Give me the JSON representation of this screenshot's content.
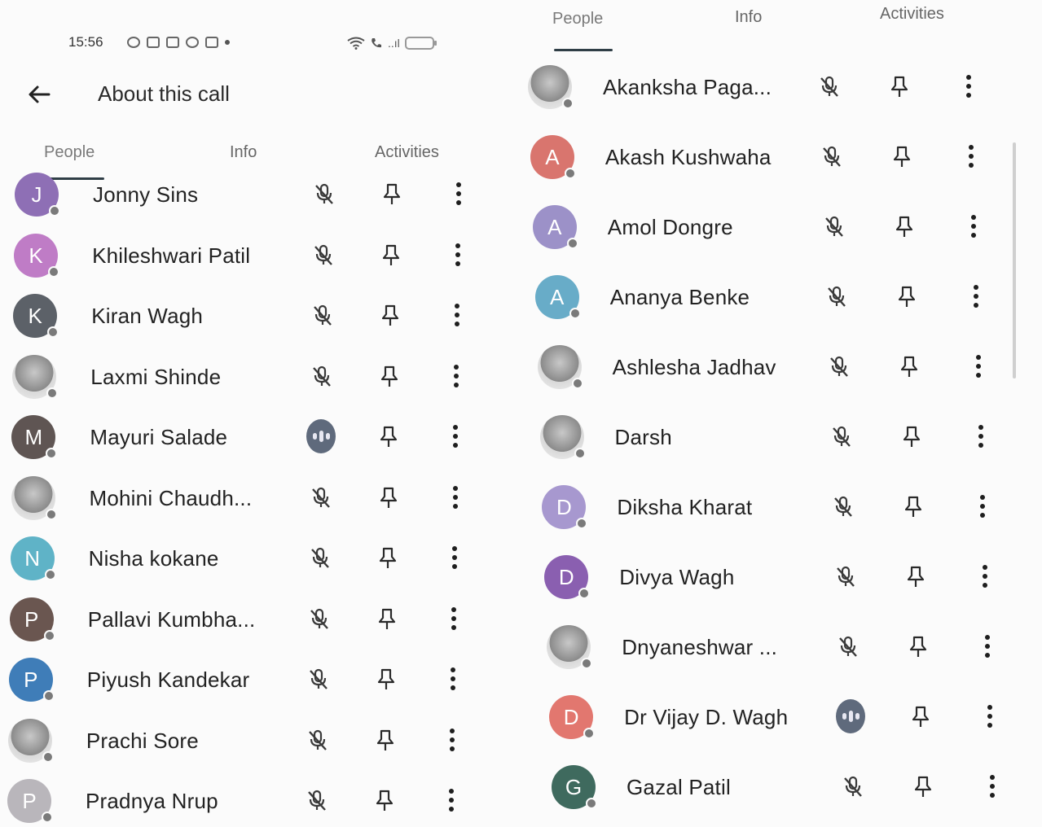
{
  "status_bar": {
    "time": "15:56",
    "signal_text": "..ıl"
  },
  "app_bar": {
    "title": "About this call",
    "back_icon": "arrow-left-icon"
  },
  "left_tabs": [
    "People",
    "Info",
    "Activities"
  ],
  "right_tabs": [
    "People",
    "Info",
    "Activities"
  ],
  "active_tab": "People",
  "colors": {
    "mic_icon": "#3a3a3a",
    "presence_dot": "#7a7a7a",
    "speaking": "#5f6a7c"
  },
  "left_people": [
    {
      "initial": "J",
      "name": "Jonny Sins",
      "color": "#8e6fb5",
      "mic": "muted"
    },
    {
      "initial": "K",
      "name": "Khileshwari Patil",
      "color": "#bf7cc6",
      "mic": "muted"
    },
    {
      "initial": "K",
      "name": "Kiran Wagh",
      "color": "#5c6168",
      "mic": "muted"
    },
    {
      "initial": "",
      "name": "Laxmi Shinde",
      "color": "photo",
      "mic": "muted"
    },
    {
      "initial": "M",
      "name": "Mayuri Salade",
      "color": "#5f5553",
      "mic": "speaking"
    },
    {
      "initial": "",
      "name": "Mohini Chaudh...",
      "color": "photo",
      "mic": "muted"
    },
    {
      "initial": "N",
      "name": "Nisha kokane",
      "color": "#5fb3c7",
      "mic": "muted"
    },
    {
      "initial": "P",
      "name": "Pallavi Kumbha...",
      "color": "#6a5650",
      "mic": "muted"
    },
    {
      "initial": "P",
      "name": "Piyush Kandekar",
      "color": "#3f7db8",
      "mic": "muted"
    },
    {
      "initial": "",
      "name": "Prachi Sore",
      "color": "photo",
      "mic": "muted"
    },
    {
      "initial": "P",
      "name": "Pradnya Nrup",
      "color": "#b9b6bb",
      "mic": "muted"
    }
  ],
  "right_people": [
    {
      "initial": "",
      "name": "Akanksha Paga...",
      "color": "photo",
      "mic": "muted"
    },
    {
      "initial": "A",
      "name": "Akash Kushwaha",
      "color": "#d9756e",
      "mic": "muted"
    },
    {
      "initial": "A",
      "name": "Amol Dongre",
      "color": "#9c91c8",
      "mic": "muted"
    },
    {
      "initial": "A",
      "name": "Ananya Benke",
      "color": "#68acc8",
      "mic": "muted"
    },
    {
      "initial": "",
      "name": "Ashlesha Jadhav",
      "color": "photo",
      "mic": "muted"
    },
    {
      "initial": "",
      "name": "Darsh",
      "color": "photo",
      "mic": "muted"
    },
    {
      "initial": "D",
      "name": "Diksha Kharat",
      "color": "#a798cf",
      "mic": "muted"
    },
    {
      "initial": "D",
      "name": "Divya Wagh",
      "color": "#8a5fb0",
      "mic": "muted"
    },
    {
      "initial": "",
      "name": "Dnyaneshwar ...",
      "color": "photo",
      "mic": "muted"
    },
    {
      "initial": "D",
      "name": "Dr Vijay D. Wagh",
      "color": "#e2776f",
      "mic": "speaking"
    },
    {
      "initial": "G",
      "name": "Gazal Patil",
      "color": "#3f6a5e",
      "mic": "muted"
    }
  ]
}
